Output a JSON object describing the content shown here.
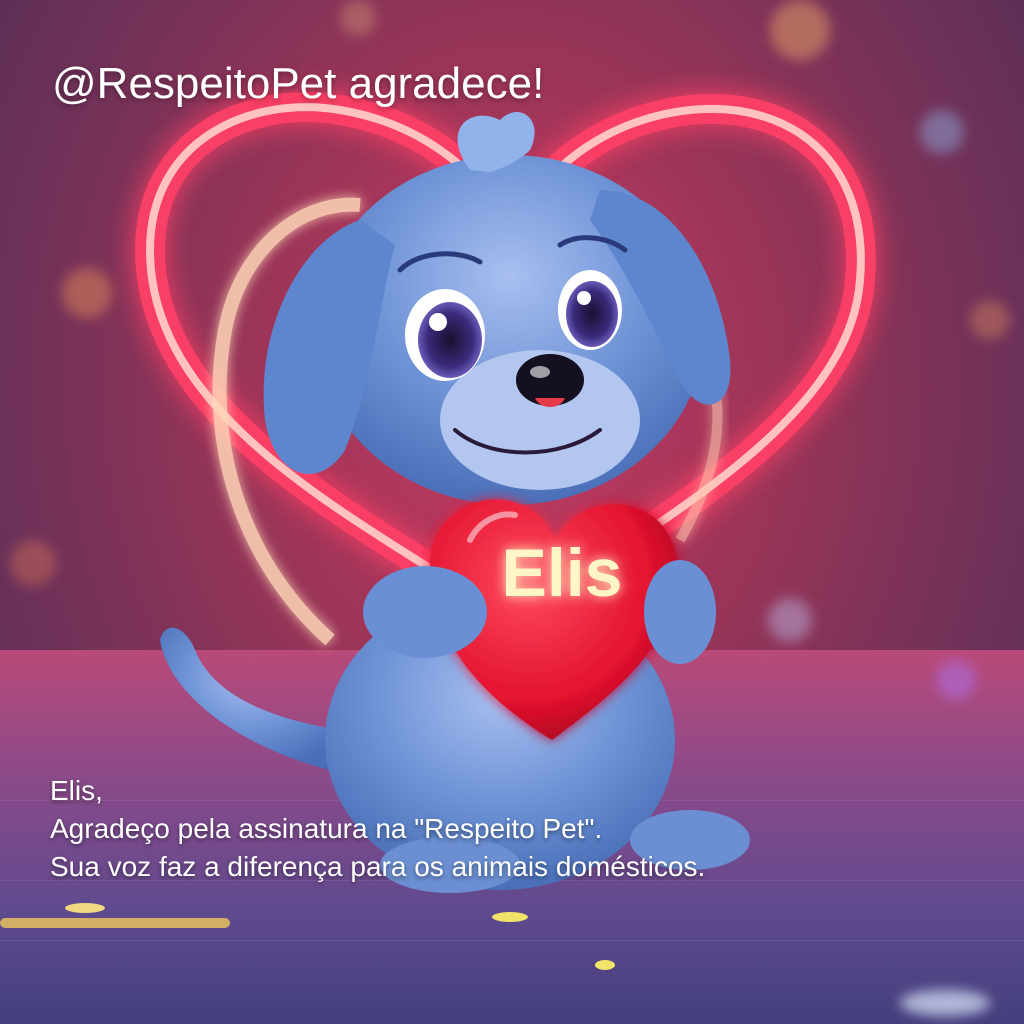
{
  "header": {
    "title": "@RespeitoPet agradece!"
  },
  "heart_label": "Elis",
  "message": {
    "line1": "Elis,",
    "line2": "Agradeço pela assinatura na \"Respeito Pet\".",
    "line3": "Sua voz faz a diferença para os animais domésticos."
  },
  "colors": {
    "neon_heart": "#ff3f66",
    "held_heart": "#e81434",
    "puppy_fur": "#5e88cf",
    "text": "#ffffff"
  },
  "icons": [
    "neon-heart-icon",
    "puppy-illustration",
    "held-heart-icon"
  ]
}
